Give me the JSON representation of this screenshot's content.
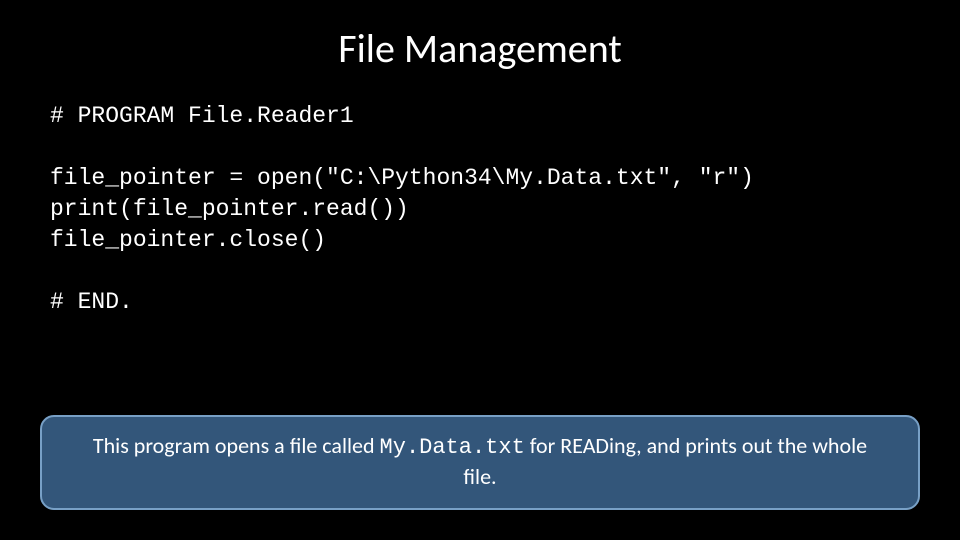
{
  "slide": {
    "title": "File Management",
    "code": {
      "line1": "# PROGRAM File.Reader1",
      "blank1": "",
      "line2": "file_pointer = open(\"C:\\Python34\\My.Data.txt\", \"r\")",
      "line3": "print(file_pointer.read())",
      "line4": "file_pointer.close()",
      "blank2": "",
      "line5": "# END."
    },
    "callout": {
      "pre": "This program opens a file called ",
      "filename": "My.Data.txt",
      "post": " for READing, and prints out the whole file."
    }
  }
}
